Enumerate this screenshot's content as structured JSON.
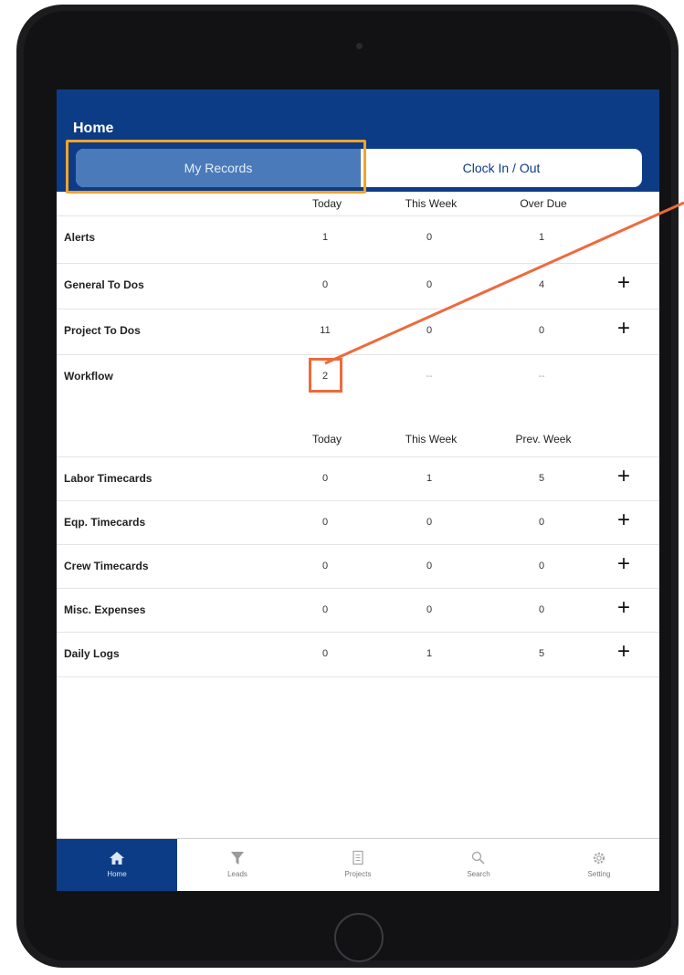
{
  "app": {
    "title": "Home"
  },
  "segments": {
    "active": "My Records",
    "inactive": "Clock In / Out"
  },
  "records_headers": [
    "Today",
    "This Week",
    "Over Due"
  ],
  "records_rows": [
    {
      "label": "Alerts",
      "values": [
        "1",
        "0",
        "1"
      ],
      "add": false
    },
    {
      "label": "General To Dos",
      "values": [
        "0",
        "0",
        "4"
      ],
      "add": true
    },
    {
      "label": "Project To Dos",
      "values": [
        "11",
        "0",
        "0"
      ],
      "add": true
    },
    {
      "label": "Workflow",
      "values": [
        "2",
        "--",
        "--"
      ],
      "add": false
    }
  ],
  "timecards_headers": [
    "Today",
    "This Week",
    "Prev. Week"
  ],
  "timecards_rows": [
    {
      "label": "Labor Timecards",
      "values": [
        "0",
        "1",
        "5"
      ],
      "add": true
    },
    {
      "label": "Eqp. Timecards",
      "values": [
        "0",
        "0",
        "0"
      ],
      "add": true
    },
    {
      "label": "Crew Timecards",
      "values": [
        "0",
        "0",
        "0"
      ],
      "add": true
    },
    {
      "label": "Misc. Expenses",
      "values": [
        "0",
        "0",
        "0"
      ],
      "add": true
    },
    {
      "label": "Daily Logs",
      "values": [
        "0",
        "1",
        "5"
      ],
      "add": true
    }
  ],
  "add_glyph": "+",
  "tabs": [
    {
      "label": "Home",
      "icon": "home-icon",
      "active": true
    },
    {
      "label": "Leads",
      "icon": "funnel-icon",
      "active": false
    },
    {
      "label": "Projects",
      "icon": "projects-icon",
      "active": false
    },
    {
      "label": "Search",
      "icon": "search-icon",
      "active": false
    },
    {
      "label": "Setting",
      "icon": "gear-icon",
      "active": false
    }
  ],
  "colors": {
    "brand": "#0d3c86",
    "segment_active": "#4a7ab9",
    "highlight": "#f5a32a",
    "callout": "#ee6a3c"
  }
}
